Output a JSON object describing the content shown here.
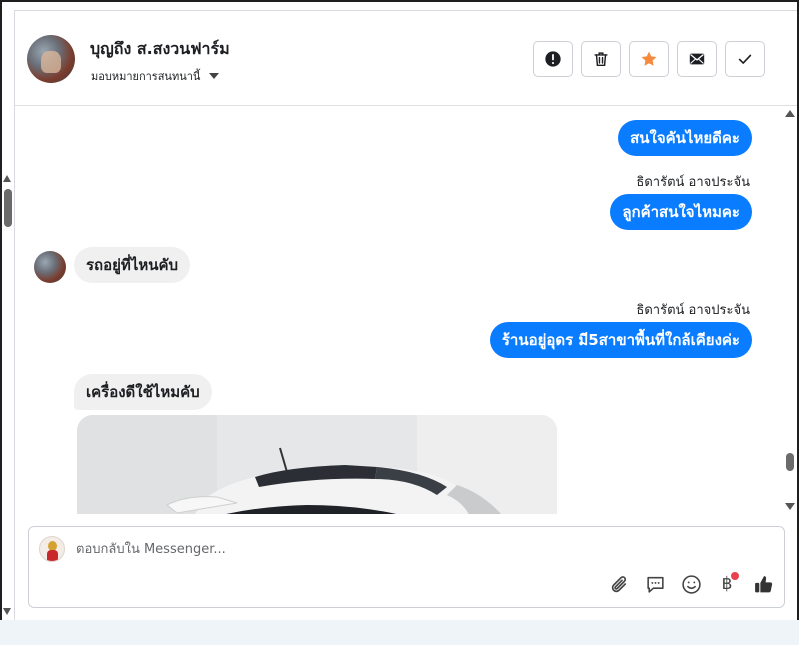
{
  "header": {
    "contact_name": "บุญถึง ส.สงวนฟาร์ม",
    "assign_label": "มอบหมายการสนทนานี้",
    "actions": [
      {
        "name": "mark-spam-button",
        "icon": "exclamation-icon"
      },
      {
        "name": "delete-button",
        "icon": "trash-icon"
      },
      {
        "name": "star-button",
        "icon": "star-icon"
      },
      {
        "name": "mark-unread-button",
        "icon": "envelope-icon"
      },
      {
        "name": "mark-done-button",
        "icon": "check-icon"
      }
    ]
  },
  "messages": [
    {
      "direction": "outgoing",
      "text": "สนใจคันไหยดีคะ"
    },
    {
      "direction": "outgoing",
      "sender": "ธิดารัตน์ อาจประจัน",
      "text": "ลูกค้าสนใจไหมคะ"
    },
    {
      "direction": "incoming",
      "text": "รถอยู่ที่ไหนคับ"
    },
    {
      "direction": "outgoing",
      "sender": "ธิดารัตน์ อาจประจัน",
      "text": "ร้านอยู่อุดร มี5สาขาพื้นที่ใกล้เคียงค่ะ"
    },
    {
      "direction": "incoming",
      "text": "เครื่องดีใช้ไหมคับ",
      "attachment": "car-photo"
    }
  ],
  "composer": {
    "placeholder": "ตอบกลับใน Messenger...",
    "value": "",
    "tools": [
      "paperclip-icon",
      "saved-reply-icon",
      "emoji-icon",
      "baht-icon",
      "like-icon"
    ],
    "baht_symbol": "฿"
  },
  "colors": {
    "outgoing_bubble": "#0a7cff",
    "incoming_bubble": "#f0f0f0",
    "star": "#f5893d",
    "notification_dot": "#e9424f"
  }
}
